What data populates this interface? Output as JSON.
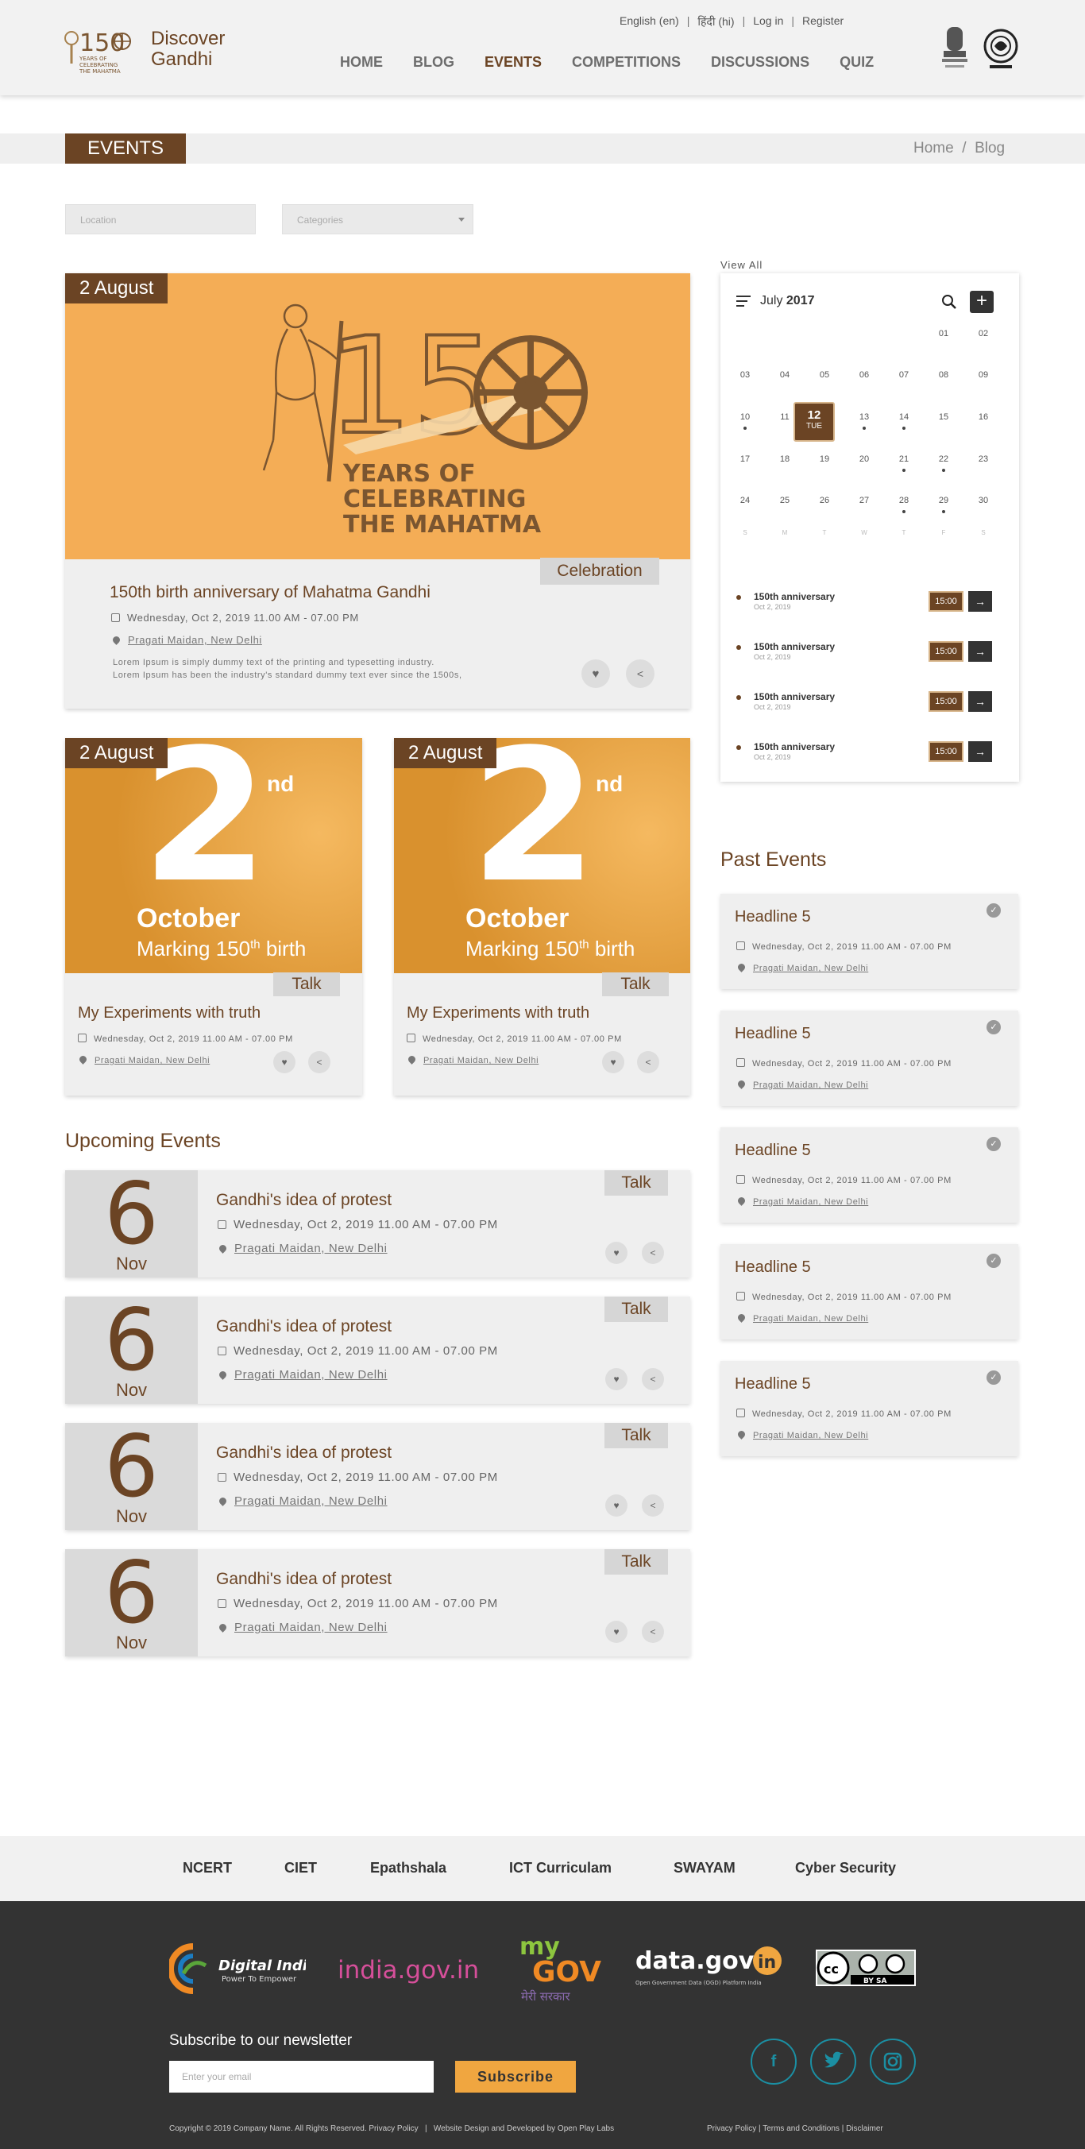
{
  "header": {
    "brand_line1": "Discover",
    "brand_line2": "Gandhi",
    "logo_caption1": "YEARS OF",
    "logo_caption2": "CELEBRATING",
    "logo_caption3": "THE MAHATMA",
    "lang_en": "English (en)",
    "lang_hi": "हिंदी (hi)",
    "login": "Log in",
    "register": "Register",
    "nav": [
      "HOME",
      "BLOG",
      "EVENTS",
      "COMPETITIONS",
      "DISCUSSIONS",
      "QUIZ"
    ],
    "active_nav": "EVENTS"
  },
  "page": {
    "title": "EVENTS",
    "breadcrumb": [
      "Home",
      "Blog"
    ],
    "filters": {
      "location": "Location",
      "categories": "Categories"
    }
  },
  "featured": {
    "date": "2 August",
    "banner_line1": "YEARS OF",
    "banner_line2": "CELEBRATING",
    "banner_line3": "THE MAHATMA",
    "tag": "Celebration",
    "title": "150th birth anniversary of Mahatma Gandhi",
    "when": "Wednesday, Oct 2, 2019 11.00 AM - 07.00 PM",
    "where": "Pragati Maidan, New Delhi",
    "desc1": "Lorem Ipsum is simply dummy text of the printing and typesetting industry.",
    "desc2": "Lorem Ipsum has been the industry's standard dummy text ever since the 1500s,"
  },
  "small_events": [
    {
      "date": "2 August",
      "big": "2",
      "sup": "nd",
      "line1": "October",
      "line2": "Marking 150",
      "line2sup": "th",
      "line2end": " birth",
      "tag": "Talk",
      "title": "My Experiments with truth",
      "when": "Wednesday, Oct 2, 2019 11.00 AM - 07.00 PM",
      "where": "Pragati Maidan, New Delhi"
    },
    {
      "date": "2 August",
      "big": "2",
      "sup": "nd",
      "line1": "October",
      "line2": "Marking 150",
      "line2sup": "th",
      "line2end": " birth",
      "tag": "Talk",
      "title": "My Experiments with truth",
      "when": "Wednesday, Oct 2, 2019 11.00 AM - 07.00 PM",
      "where": "Pragati Maidan, New Delhi"
    }
  ],
  "upcoming": {
    "heading": "Upcoming Events",
    "items": [
      {
        "day": "6",
        "month": "Nov",
        "title": "Gandhi's idea of protest",
        "when": "Wednesday, Oct 2, 2019 11.00 AM - 07.00 PM",
        "where": "Pragati Maidan, New Delhi",
        "tag": "Talk"
      },
      {
        "day": "6",
        "month": "Nov",
        "title": "Gandhi's idea of protest",
        "when": "Wednesday, Oct 2, 2019 11.00 AM - 07.00 PM",
        "where": "Pragati Maidan, New Delhi",
        "tag": "Talk"
      },
      {
        "day": "6",
        "month": "Nov",
        "title": "Gandhi's idea of protest",
        "when": "Wednesday, Oct 2, 2019 11.00 AM - 07.00 PM",
        "where": "Pragati Maidan, New Delhi",
        "tag": "Talk"
      },
      {
        "day": "6",
        "month": "Nov",
        "title": "Gandhi's idea of protest",
        "when": "Wednesday, Oct 2, 2019 11.00 AM - 07.00 PM",
        "where": "Pragati Maidan, New Delhi",
        "tag": "Talk"
      }
    ]
  },
  "calendar": {
    "view_all": "View All",
    "month": "July",
    "year": "2017",
    "weeks": [
      [
        "",
        "",
        "",
        "",
        "",
        "01",
        "02"
      ],
      [
        "03",
        "04",
        "05",
        "06",
        "07",
        "08",
        "09"
      ],
      [
        "10",
        "11",
        "12",
        "13",
        "14",
        "15",
        "16"
      ],
      [
        "17",
        "18",
        "19",
        "20",
        "21",
        "22",
        "23"
      ],
      [
        "24",
        "25",
        "26",
        "27",
        "28",
        "29",
        "30"
      ]
    ],
    "selected_day": "12",
    "selected_weekday": "TUE",
    "weekdays": [
      "S",
      "M",
      "T",
      "W",
      "T",
      "F",
      "S"
    ],
    "events": [
      {
        "name": "150th anniversary",
        "date": "Oct 2, 2019",
        "time": "15:00"
      },
      {
        "name": "150th anniversary",
        "date": "Oct 2, 2019",
        "time": "15:00"
      },
      {
        "name": "150th anniversary",
        "date": "Oct 2, 2019",
        "time": "15:00"
      },
      {
        "name": "150th anniversary",
        "date": "Oct 2, 2019",
        "time": "15:00"
      }
    ]
  },
  "past": {
    "heading": "Past Events",
    "items": [
      {
        "title": "Headline 5",
        "when": "Wednesday, Oct 2, 2019 11.00 AM - 07.00 PM",
        "where": "Pragati Maidan, New Delhi"
      },
      {
        "title": "Headline 5",
        "when": "Wednesday, Oct 2, 2019 11.00 AM - 07.00 PM",
        "where": "Pragati Maidan, New Delhi"
      },
      {
        "title": "Headline 5",
        "when": "Wednesday, Oct 2, 2019 11.00 AM - 07.00 PM",
        "where": "Pragati Maidan, New Delhi"
      },
      {
        "title": "Headline 5",
        "when": "Wednesday, Oct 2, 2019 11.00 AM - 07.00 PM",
        "where": "Pragati Maidan, New Delhi"
      },
      {
        "title": "Headline 5",
        "when": "Wednesday, Oct 2, 2019 11.00 AM - 07.00 PM",
        "where": "Pragati Maidan, New Delhi"
      }
    ]
  },
  "footer": {
    "links": [
      "NCERT",
      "CIET",
      "Epathshala",
      "ICT Curriculam",
      "SWAYAM",
      "Cyber Security"
    ],
    "partners": {
      "digital_india": "Digital India",
      "digital_india_sub": "Power To Empower",
      "india_gov": "india.gov.in",
      "mygov_1": "my",
      "mygov_2": "GOV",
      "mygov_3": "मेरी सरकार",
      "datagov": "data.gov",
      "datagov_in": "in",
      "datagov_sub": "Open Government Data (OGD) Platform India",
      "cc": "BY  SA"
    },
    "newsletter_title": "Subscribe to our newsletter",
    "email_placeholder": "Enter your email",
    "subscribe": "Subscribe",
    "social": [
      "f",
      "t",
      "ig"
    ],
    "copyright": "Copyright © 2019 Company Name. All Rights Reserved. Privacy Policy",
    "credits": "Website Design and Developed by Open Play Labs",
    "legal": "Privacy Policy | Terms and Conditions | Disclaimer"
  },
  "colors": {
    "brand_brown": "#6b4424",
    "banner_orange": "#f4ad56",
    "card_grey": "#efefef",
    "accent_teal": "#1b8fa3",
    "footer_dark": "#333333"
  }
}
